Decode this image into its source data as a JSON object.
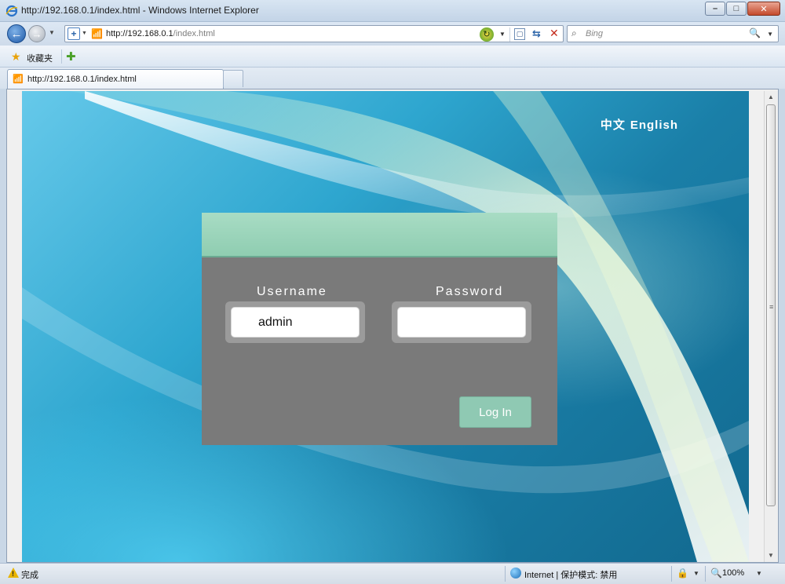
{
  "window": {
    "title": "http://192.168.0.1/index.html - Windows Internet Explorer",
    "minimize_glyph": "–",
    "maximize_glyph": "□",
    "close_glyph": "✕"
  },
  "navbar": {
    "back_glyph": "←",
    "forward_glyph": "→",
    "address_host": "http://192.168.0.1",
    "address_path": "/index.html",
    "search_placeholder": "Bing"
  },
  "favorites_bar": {
    "favorites_label": "收藏夹"
  },
  "tabs": [
    {
      "label": "http://192.168.0.1/index.html"
    }
  ],
  "page": {
    "language_links": [
      "中文",
      "English"
    ],
    "login": {
      "username_label": "Username",
      "username_value": "admin",
      "password_label": "Password",
      "password_value": "",
      "login_button": "Log In"
    },
    "colors": {
      "panel": "#7a7a7a",
      "header_green": "#9ad5bb",
      "button_green": "#8fc9b3"
    }
  },
  "statusbar": {
    "status_text": "完成",
    "zone_text": "Internet | 保护模式: 禁用",
    "zoom_text": "100%"
  }
}
